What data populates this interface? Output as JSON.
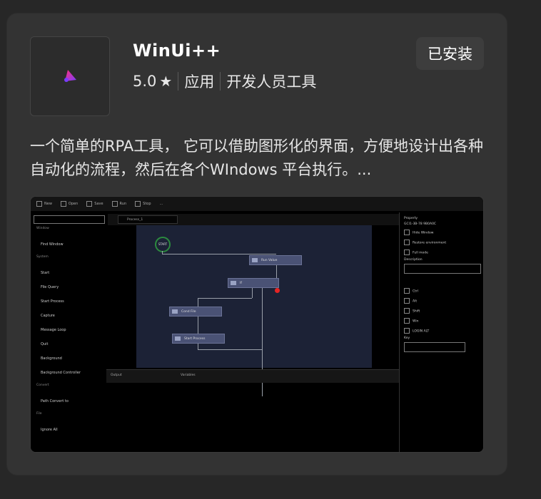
{
  "app": {
    "title": "WinUi++",
    "rating": "5.0",
    "type": "应用",
    "category": "开发人员工具",
    "installed_label": "已安装",
    "description": "一个简单的RPA工具， 它可以借助图形化的界面，方便地设计出各种自动化的流程，然后在各个WIndows 平台执行。..."
  },
  "icons": {
    "app_logo": "winui-logo-icon",
    "rating_star": "star-icon"
  },
  "colors": {
    "card_bg": "#333333",
    "page_bg": "#272727",
    "button_bg": "#3d3d3d",
    "logo_gradient_start": "#ff2e7e",
    "logo_gradient_end": "#7a3cff"
  },
  "screenshot": {
    "toolbar": [
      "New",
      "Open",
      "Save",
      "Run",
      "Stop",
      "..."
    ],
    "tab_title": "Process_1",
    "left_pane": {
      "cat_window": "Window",
      "cat_system": "System",
      "cat_convert": "Convert",
      "cat_file": "File",
      "items": [
        "Find Window",
        "Start",
        "File Query",
        "Start Process",
        "Capture",
        "Message Loop",
        "Quit",
        "Background",
        "Background Controller",
        "Path Convert to",
        "Ignore All"
      ]
    },
    "nodes": {
      "start": "START",
      "n1": "Run Value",
      "n2": "If",
      "n3": "Cond File",
      "n4": "Start Process"
    },
    "right_pane": {
      "title": "Property",
      "id": "GCI1-3B-78 9B0A0C",
      "checks": [
        "Hide Window",
        "Restore environment",
        "Full mode"
      ],
      "desc_label": "Description",
      "mods": [
        "Ctrl",
        "Alt",
        "Shift",
        "Win",
        "LOGIN ALT"
      ],
      "key_label": "Key"
    },
    "bottom_tabs": [
      "Output",
      "Variables"
    ]
  }
}
